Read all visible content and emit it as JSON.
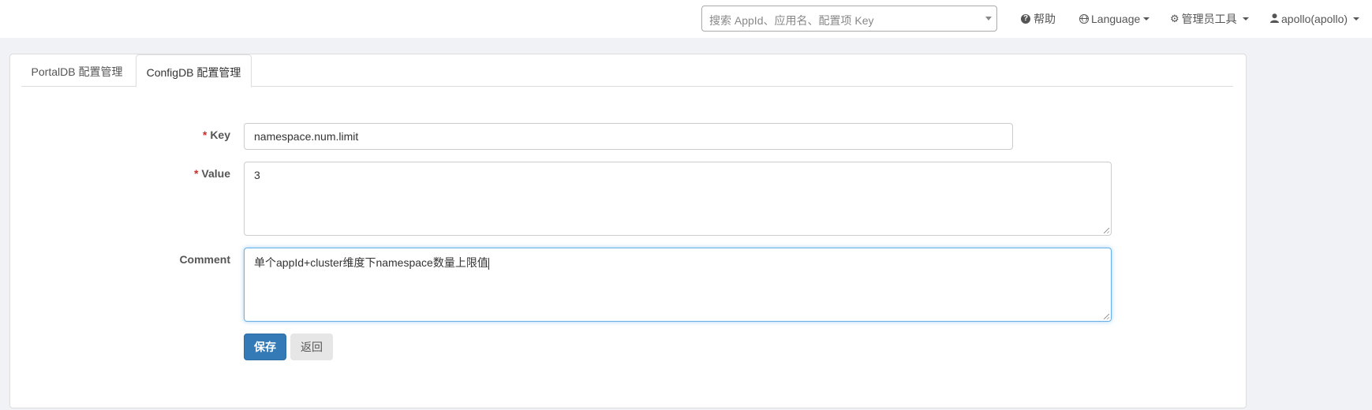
{
  "navbar": {
    "search_placeholder": "搜索 AppId、应用名、配置项 Key",
    "help_label": "帮助",
    "language_label": "Language",
    "admin_tools_label": "管理员工具",
    "user_label": "apollo(apollo)"
  },
  "tabs": [
    {
      "label": "PortalDB 配置管理",
      "active": false
    },
    {
      "label": "ConfigDB 配置管理",
      "active": true
    }
  ],
  "form": {
    "key": {
      "label": "Key",
      "required": "*",
      "value": "namespace.num.limit"
    },
    "value": {
      "label": "Value",
      "required": "*",
      "value": "3"
    },
    "comment": {
      "label": "Comment",
      "value": "单个appId+cluster维度下namespace数量上限值"
    }
  },
  "buttons": {
    "save_label": "保存",
    "back_label": "返回"
  },
  "colors": {
    "primary": "#337ab7",
    "required": "#c9302c",
    "focus_border": "#66afe9",
    "background": "#f1f2f5"
  }
}
